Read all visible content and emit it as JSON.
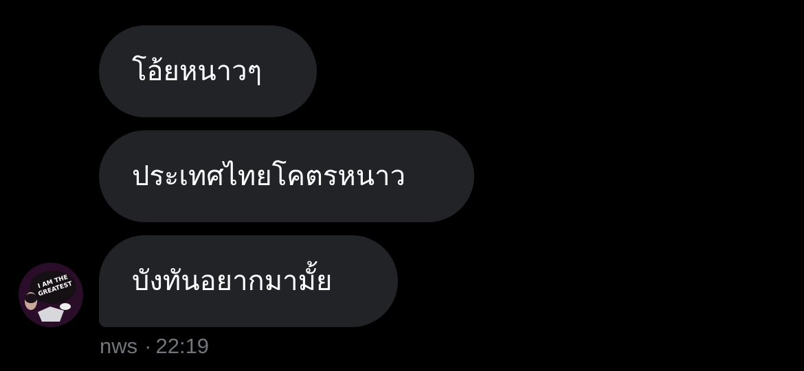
{
  "messages": [
    {
      "text": "โอ้ยหนาวๆ"
    },
    {
      "text": "ประเทศไทยโคตรหนาว"
    },
    {
      "text": "บังทันอยากมามั้ย"
    }
  ],
  "sender": {
    "name": "nws",
    "separator": "·",
    "time": "22:19",
    "avatar_text": "I AM THE GREATEST"
  },
  "colors": {
    "background": "#000000",
    "bubble": "#212327",
    "message_text": "#ffffff",
    "meta_text": "#71767b",
    "avatar_bg": "#2a0d28"
  }
}
